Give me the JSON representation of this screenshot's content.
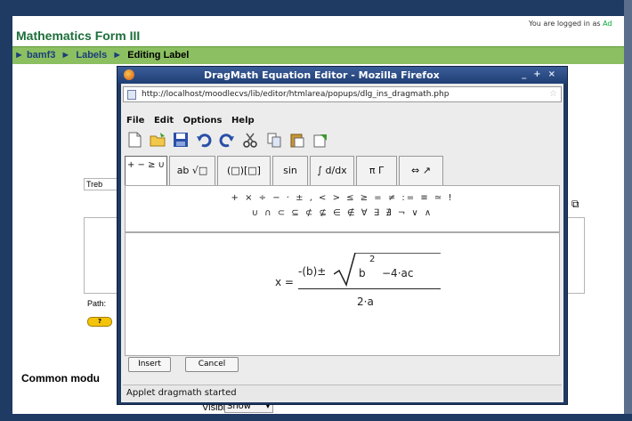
{
  "header": {
    "logged_in_text": "You are logged in as",
    "logged_in_user": "Ad",
    "course_title": "Mathematics Form III"
  },
  "breadcrumb": {
    "items": [
      "bamf3",
      "Labels"
    ],
    "current": "Editing Label",
    "separator": "►"
  },
  "background_form": {
    "font_select": "Treb",
    "path_label": "Path:",
    "help_badge": "?",
    "common_modules": "Common modu",
    "visible_label": "Visible",
    "visible_value": "Show"
  },
  "popup": {
    "title": "DragMath Equation Editor - Mozilla Firefox",
    "url": "http://localhost/moodlecvs/lib/editor/htmlarea/popups/dlg_ins_dragmath.php",
    "menu": [
      "File",
      "Edit",
      "Options",
      "Help"
    ],
    "toolbar_icons": [
      "new-icon",
      "open-icon",
      "save-icon",
      "undo-icon",
      "redo-icon",
      "cut-icon",
      "copy-icon",
      "paste-icon",
      "export-icon"
    ],
    "tabs": [
      "+ − ≥ ∪",
      "ab √□",
      "(□)[□]",
      "sin",
      "∫ d/dx",
      "π Γ",
      "⇔ ↗"
    ],
    "palette_row1": "+ × ÷ − · ± , < > ≤ ≥ = ≠ := ≡ ≃ !",
    "palette_row2": "∪ ∩ ⊂ ⊆ ⊄ ⊈ ∈ ∉ ∀ ∃ ∄ ¬ ∨ ∧",
    "equation": {
      "lhs": "x =",
      "numerator_prefix": "-(b)±",
      "radicand_base": "b",
      "radicand_exp": "2",
      "radicand_rest": "−4·ac",
      "denominator": "2·a"
    },
    "insert_label": "Insert",
    "cancel_label": "Cancel",
    "status": "Applet dragmath started"
  },
  "colors": {
    "window_frame": "#1f3a63",
    "navbar": "#8bbf61",
    "course_title": "#1d6e3b"
  }
}
